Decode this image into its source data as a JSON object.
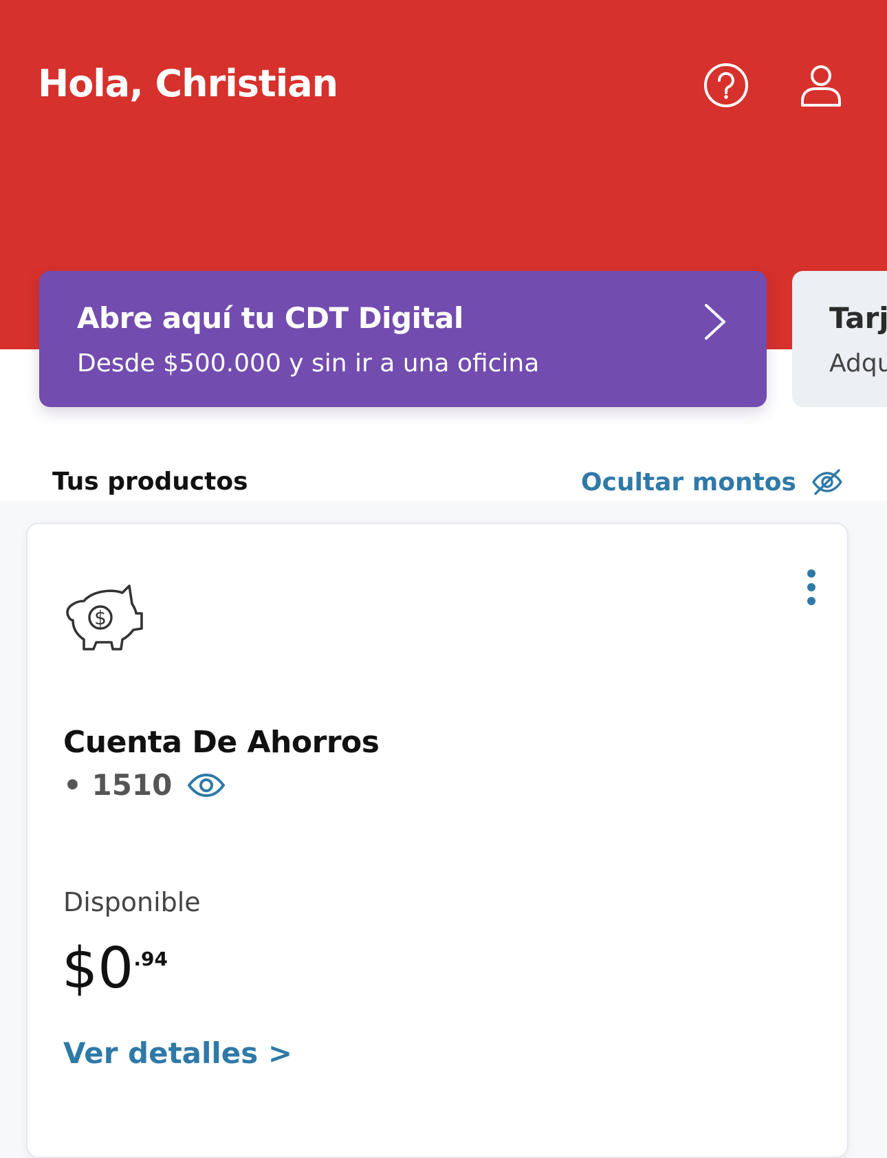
{
  "header": {
    "greeting": "Hola, Christian",
    "help_icon": "help-circle-icon",
    "profile_icon": "user-icon",
    "background_color": "#d6312c"
  },
  "promos": [
    {
      "title": "Abre aquí tu CDT Digital",
      "subtitle": "Desde $500.000 y sin ir a una oficina",
      "icon": "chevron-right-icon",
      "background_color": "#724caf"
    },
    {
      "title": "Tarj",
      "subtitle": "Adqu",
      "background_color": "#eceff3"
    }
  ],
  "products": {
    "title": "Tus productos",
    "hide_amounts_label": "Ocultar montos",
    "hide_amounts_icon": "eye-off-icon",
    "accent_color": "#2f79a8"
  },
  "account": {
    "icon": "piggy-bank-icon",
    "menu_icon": "more-vertical-icon",
    "name": "Cuenta De Ahorros",
    "number": "• 1510",
    "number_icon": "eye-icon",
    "available_label": "Disponible",
    "balance_main": "$0",
    "balance_cents": ".94",
    "details_link": "Ver detalles >"
  }
}
